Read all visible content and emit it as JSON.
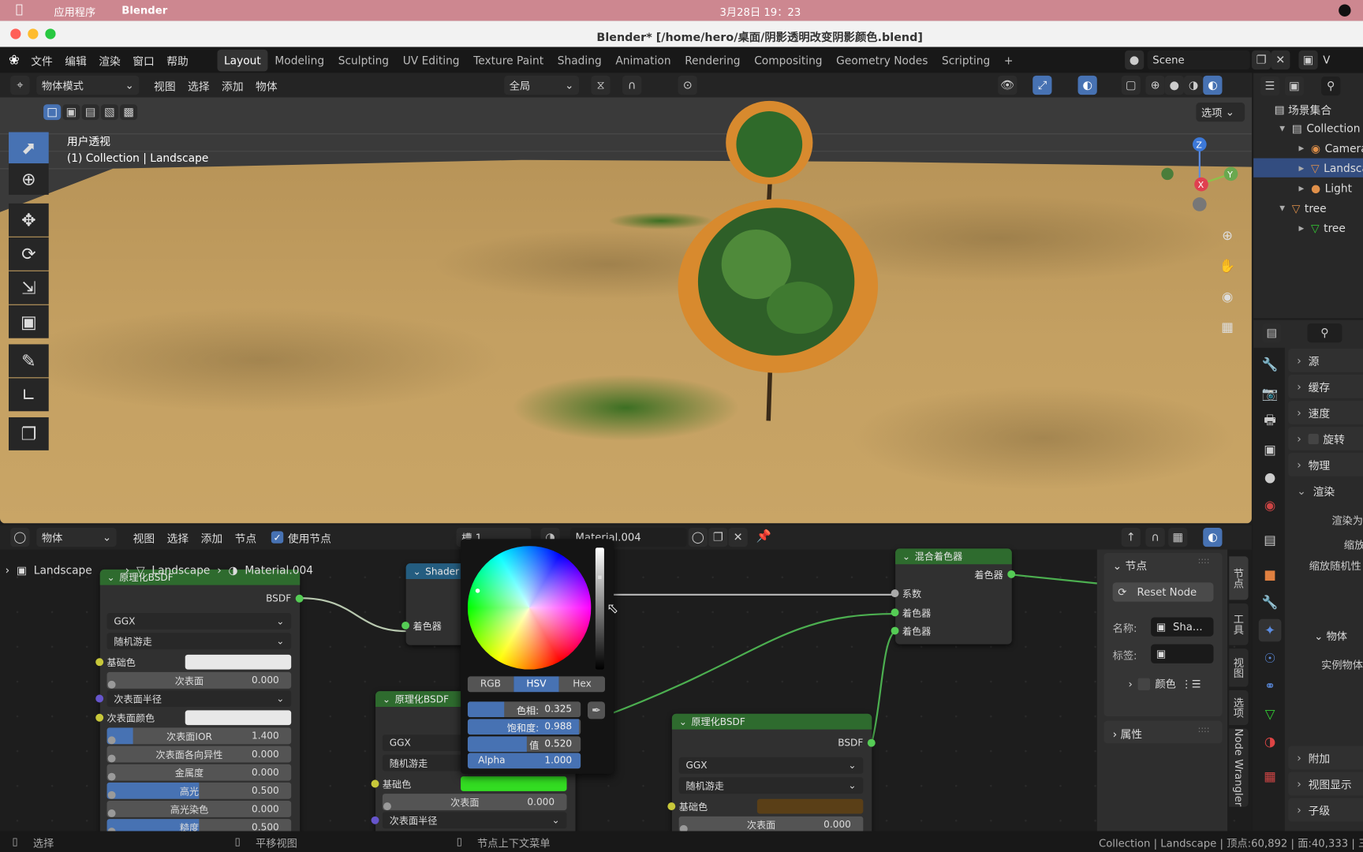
{
  "mac_bar": {
    "apps_label": "应用程序",
    "app_name": "Blender",
    "datetime": "3月28日 19：23"
  },
  "window": {
    "title": "Blender* [/home/hero/桌面/阴影透明改变阴影颜色.blend]",
    "traffic_colors": [
      "#ff5f57",
      "#febc2e",
      "#28c840"
    ]
  },
  "topbar": {
    "menus": [
      "文件",
      "编辑",
      "渲染",
      "窗口",
      "帮助"
    ],
    "workspaces": [
      "Layout",
      "Modeling",
      "Sculpting",
      "UV Editing",
      "Texture Paint",
      "Shading",
      "Animation",
      "Rendering",
      "Compositing",
      "Geometry Nodes",
      "Scripting"
    ],
    "active_workspace": "Layout",
    "add_workspace": "+",
    "scene": "Scene",
    "view_layer": "V"
  },
  "viewport": {
    "mode": "物体模式",
    "menus": [
      "视图",
      "选择",
      "添加",
      "物体"
    ],
    "transform_orientation": "全局",
    "options_label": "选项",
    "overlay_title": "用户透视",
    "overlay_subtitle": "(1) Collection | Landscape",
    "gizmo_axes": {
      "z": "Z",
      "y": "Y",
      "x": "X"
    },
    "tools": [
      "select-box",
      "cursor",
      "move",
      "rotate",
      "scale",
      "transform",
      "annotate",
      "measure",
      "add-cube"
    ]
  },
  "outliner": {
    "root": "场景集合",
    "items": [
      {
        "label": "Collection",
        "icon": "collection-icon",
        "level": 1
      },
      {
        "label": "Camera",
        "icon": "camera-icon",
        "level": 2
      },
      {
        "label": "Landscape",
        "icon": "mesh-icon",
        "level": 2,
        "selected": true
      },
      {
        "label": "Light",
        "icon": "light-icon",
        "level": 2
      },
      {
        "label": "tree",
        "icon": "mesh-icon",
        "level": 1
      },
      {
        "label": "tree",
        "icon": "particles-icon",
        "level": 2
      }
    ]
  },
  "properties": {
    "sections": [
      "源",
      "缓存",
      "速度",
      "旋转",
      "物理",
      "渲染"
    ],
    "render_labels": [
      "渲染为",
      "缩放",
      "缩放随机性"
    ],
    "object_section": "物体",
    "object_label": "实例物体",
    "bottom_sections": [
      "附加",
      "视图显示",
      "子级"
    ]
  },
  "node_editor": {
    "object_mode": "物体",
    "menus": [
      "视图",
      "选择",
      "添加",
      "节点"
    ],
    "use_nodes_label": "使用节点",
    "use_nodes_checked": true,
    "slot": "槽 1",
    "material": "Material.004",
    "breadcrumb": [
      "Landscape",
      "Landscape",
      "Material.004"
    ],
    "nodes": {
      "bsdf1": {
        "title": "原理化BSDF",
        "output": "BSDF",
        "distribution": "GGX",
        "subsurface_method": "随机游走",
        "base_color_label": "基础色",
        "base_color": "#e8e8e8",
        "subsurface_label": "次表面",
        "subsurface": "0.000",
        "subsurface_radius_label": "次表面半径",
        "subsurface_color_label": "次表面颜色",
        "subsurface_color": "#e8e8e8",
        "subsurface_ior_label": "次表面IOR",
        "subsurface_ior": "1.400",
        "subsurface_aniso_label": "次表面各向异性",
        "subsurface_aniso": "0.000",
        "metallic_label": "金属度",
        "metallic": "0.000",
        "specular_label": "高光",
        "specular": "0.500",
        "specular_tint_label": "高光染色",
        "specular_tint": "0.000",
        "roughness_label": "糙度",
        "roughness": "0.500"
      },
      "shader": {
        "title": "Shader",
        "input": "着色器"
      },
      "bsdf2": {
        "title": "原理化BSDF",
        "distribution": "GGX",
        "subsurface_method": "随机游走",
        "base_color_label": "基础色",
        "base_color": "#33dd22",
        "subsurface_label": "次表面",
        "subsurface": "0.000",
        "subsurface_radius_label": "次表面半径"
      },
      "bsdf3": {
        "title": "原理化BSDF",
        "output": "BSDF",
        "distribution": "GGX",
        "subsurface_method": "随机游走",
        "base_color_label": "基础色",
        "base_color": "#5a3f17",
        "subsurface_label": "次表面",
        "subsurface": "0.000"
      },
      "mix": {
        "title": "混合着色器",
        "output": "着色器",
        "fac": "系数",
        "shader1": "着色器",
        "shader2": "着色器"
      }
    },
    "color_picker": {
      "modes": [
        "RGB",
        "HSV",
        "Hex"
      ],
      "active_mode": "HSV",
      "hue_label": "色相:",
      "hue": "0.325",
      "hue_value": 0.325,
      "sat_label": "饱和度:",
      "sat": "0.988",
      "sat_value": 0.988,
      "val_label": "值",
      "val": "0.520",
      "val_value": 0.52,
      "alpha_label": "Alpha",
      "alpha": "1.000",
      "alpha_value": 1.0
    },
    "n_panel": {
      "node_section": "节点",
      "reset_node": "Reset Node",
      "name_label": "名称:",
      "name_value": "Sha...",
      "label_label": "标签:",
      "label_value": "",
      "color_label": "颜色",
      "properties_section": "属性",
      "tabs": [
        "节点",
        "工具",
        "视图",
        "选项",
        "Node Wrangler"
      ]
    }
  },
  "status_bar": {
    "select": "选择",
    "pan_view": "平移视图",
    "context_menu": "节点上下文菜单",
    "stats": "Collection | Landscape | 顶点:60,892 | 面:40,333 | 三"
  }
}
